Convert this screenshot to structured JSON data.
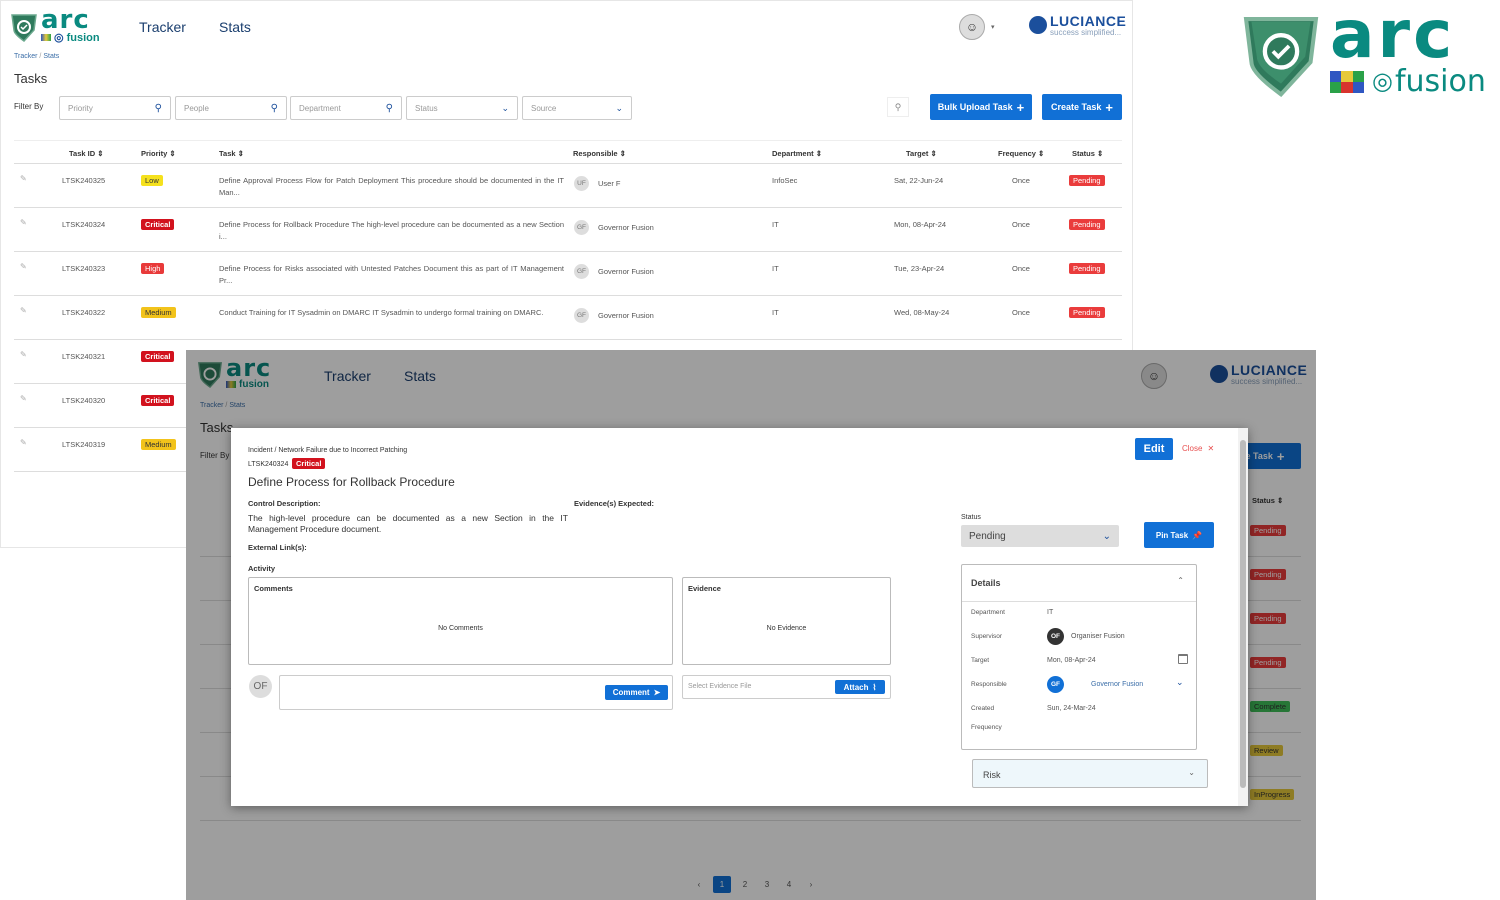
{
  "brand": {
    "wordmark": "arc",
    "sub": "fusion"
  },
  "nav": {
    "tracker": "Tracker",
    "stats": "Stats"
  },
  "luciance": {
    "name": "LUCIANCE",
    "tag": "success simplified..."
  },
  "breadcrumb": {
    "a": "Tracker",
    "sep": "/",
    "b": "Stats"
  },
  "page_title": "Tasks",
  "filters": {
    "label": "Filter By",
    "priority": "Priority",
    "people": "People",
    "department": "Department",
    "status": "Status",
    "source": "Source"
  },
  "buttons": {
    "bulk": "Bulk Upload Task",
    "create": "Create Task",
    "create_partial": "te Task"
  },
  "columns": [
    "Task ID",
    "Priority",
    "Task",
    "Responsible",
    "Department",
    "Target",
    "Frequency",
    "Status"
  ],
  "rows": [
    {
      "id": "LTSK240325",
      "priority": "Low",
      "task": "Define Approval Process Flow for Patch Deployment This procedure should be documented in the IT Man...",
      "resp_initials": "UF",
      "resp": "User F",
      "dept": "InfoSec",
      "target": "Sat, 22-Jun-24",
      "freq": "Once",
      "status": "Pending"
    },
    {
      "id": "LTSK240324",
      "priority": "Critical",
      "task": "Define Process for Rollback Procedure The high-level procedure can be documented as a new Section i...",
      "resp_initials": "GF",
      "resp": "Governor Fusion",
      "dept": "IT",
      "target": "Mon, 08-Apr-24",
      "freq": "Once",
      "status": "Pending"
    },
    {
      "id": "LTSK240323",
      "priority": "High",
      "task": "Define Process for Risks associated with Untested Patches Document this as part of IT Management Pr...",
      "resp_initials": "GF",
      "resp": "Governor Fusion",
      "dept": "IT",
      "target": "Tue, 23-Apr-24",
      "freq": "Once",
      "status": "Pending"
    },
    {
      "id": "LTSK240322",
      "priority": "Medium",
      "task": "Conduct Training for IT Sysadmin on DMARC IT Sysadmin to undergo formal training on DMARC.",
      "resp_initials": "GF",
      "resp": "Governor Fusion",
      "dept": "IT",
      "target": "Wed, 08-May-24",
      "freq": "Once",
      "status": "Pending"
    },
    {
      "id": "LTSK240321",
      "priority": "Critical"
    },
    {
      "id": "LTSK240320",
      "priority": "Critical"
    },
    {
      "id": "LTSK240319",
      "priority": "Medium"
    }
  ],
  "bg_statuses": [
    "Pending",
    "Pending",
    "Pending",
    "Pending",
    "Complete",
    "Review",
    "InProgress"
  ],
  "modal": {
    "breadcrumb": "Incident / Network Failure due to Incorrect Patching",
    "task_id": "LTSK240324",
    "priority": "Critical",
    "title": "Define Process for Rollback Procedure",
    "edit": "Edit",
    "close": "Close",
    "control_label": "Control Description:",
    "control_text": "The high-level procedure can be documented as a new Section in the IT Management Procedure document.",
    "evidence_expected": "Evidence(s) Expected:",
    "external_links": "External Link(s):",
    "activity": "Activity",
    "comments_title": "Comments",
    "no_comments": "No Comments",
    "evidence_title": "Evidence",
    "no_evidence": "No Evidence",
    "user_initials": "OF",
    "comment_btn": "Comment",
    "evidence_placeholder": "Select Evidence File",
    "attach_btn": "Attach",
    "status_label": "Status",
    "status_value": "Pending",
    "pin_btn": "Pin Task",
    "details_title": "Details",
    "details": {
      "department_label": "Department",
      "department": "IT",
      "supervisor_label": "Supervisor",
      "supervisor_initials": "OF",
      "supervisor": "Organiser Fusion",
      "target_label": "Target",
      "target": "Mon, 08-Apr-24",
      "responsible_label": "Responsible",
      "responsible_initials": "GF",
      "responsible": "Governor Fusion",
      "created_label": "Created",
      "created": "Sun, 24-Mar-24",
      "frequency_label": "Frequency"
    },
    "risk_title": "Risk"
  },
  "pagination": [
    "1",
    "2",
    "3",
    "4"
  ],
  "colors": {
    "teal": "#0a8a80",
    "blue": "#1170d6",
    "critical": "#d2121e",
    "pending": "#ea3c3c"
  }
}
